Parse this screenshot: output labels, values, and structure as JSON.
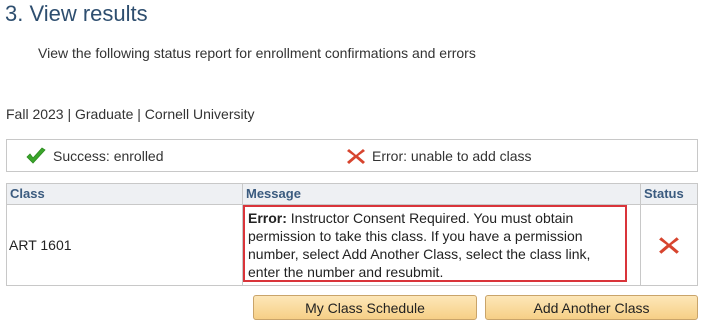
{
  "step": {
    "title": "3.  View results",
    "description": "View the following status report for enrollment confirmations and errors"
  },
  "term_info": "Fall 2023 | Graduate | Cornell University",
  "legend": {
    "success_label": "Success: enrolled",
    "error_label": "Error: unable to add class",
    "success_icon": "checkmark-icon",
    "error_icon": "x-icon"
  },
  "table": {
    "headers": {
      "class": "Class",
      "message": "Message",
      "status": "Status"
    },
    "rows": [
      {
        "class": "ART 1601",
        "message_prefix": "Error:",
        "message_text": " Instructor Consent Required. You must obtain permission to take this class. If you have a permission number, select Add Another Class, select the class link, enter the number and resubmit.",
        "status_icon": "x-icon"
      }
    ]
  },
  "buttons": {
    "schedule": "My Class Schedule",
    "add_another": "Add Another Class"
  },
  "colors": {
    "title": "#2e4e6f",
    "success": "#3aa52a",
    "error": "#d7442e",
    "highlight": "#d9343a",
    "button": "#f6cf86"
  }
}
